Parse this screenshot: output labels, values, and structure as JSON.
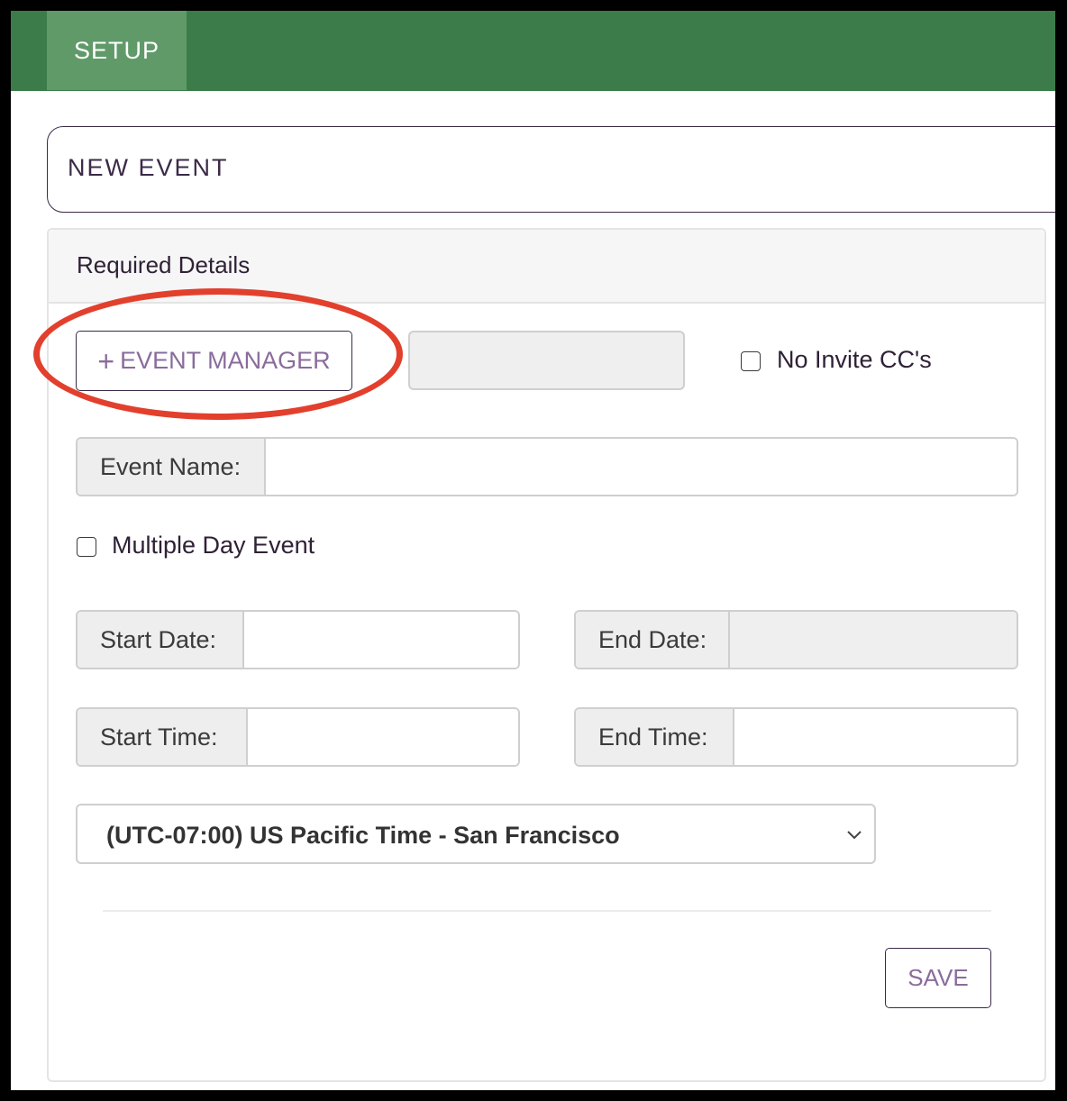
{
  "topbar": {
    "tab_label": "SETUP"
  },
  "title_box": {
    "text": "NEW EVENT"
  },
  "panel": {
    "header": "Required Details",
    "event_manager_button": {
      "icon": "plus-icon",
      "label": "EVENT MANAGER"
    },
    "no_invite_cc": {
      "label": "No Invite CC's",
      "checked": false
    },
    "event_name": {
      "label": "Event Name:",
      "value": ""
    },
    "multiple_day_event": {
      "label": "Multiple Day Event",
      "checked": false
    },
    "start_date": {
      "label": "Start Date:",
      "value": ""
    },
    "end_date": {
      "label": "End Date:",
      "value": ""
    },
    "start_time": {
      "label": "Start Time:",
      "value": ""
    },
    "end_time": {
      "label": "End Time:",
      "value": ""
    },
    "timezone": {
      "selected": "(UTC-07:00) US Pacific Time - San Francisco"
    },
    "save_button": "SAVE"
  },
  "colors": {
    "topbar": "#3b7c4a",
    "topbar_tab": "#619a69",
    "accent_text": "#8a6c9c",
    "annotation": "#e2402d"
  }
}
